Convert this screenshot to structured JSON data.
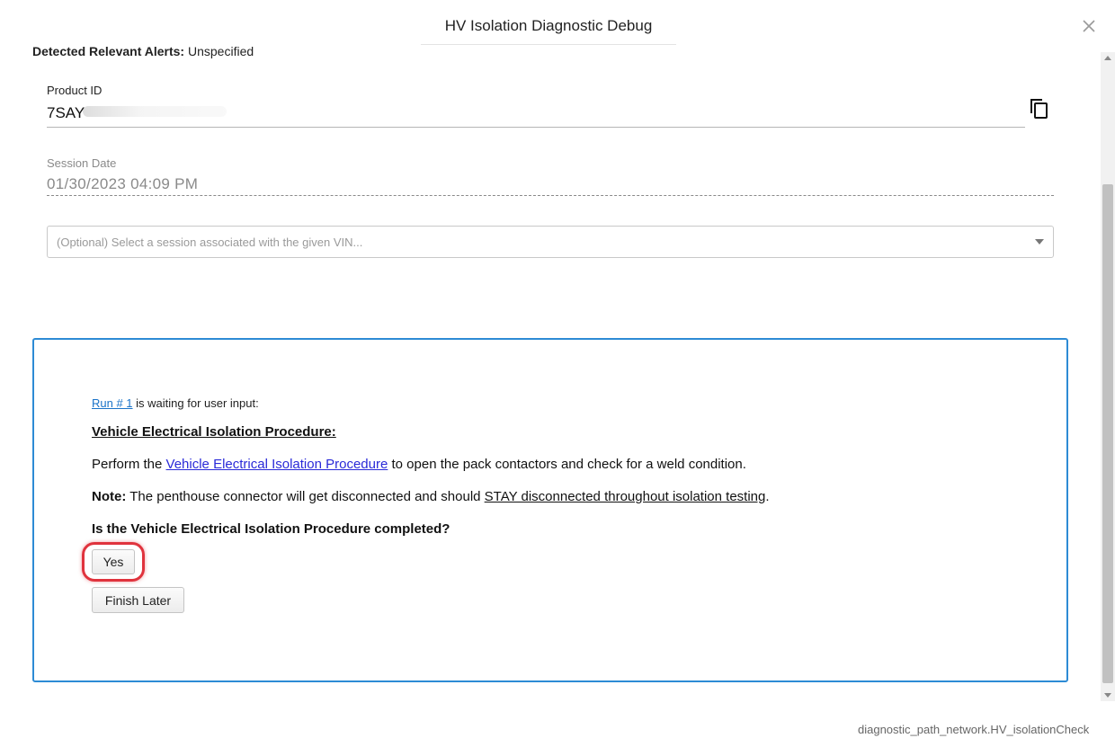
{
  "modal": {
    "title": "HV Isolation Diagnostic Debug",
    "close_icon": "close-icon"
  },
  "alerts": {
    "label": "Detected Relevant Alerts:",
    "value": "Unspecified"
  },
  "product": {
    "label": "Product ID",
    "value": "7SAY",
    "copy_icon": "copy-icon"
  },
  "session_date": {
    "label": "Session Date",
    "value": "01/30/2023 04:09 PM"
  },
  "session_select": {
    "placeholder": "(Optional) Select a session associated with the given VIN..."
  },
  "run": {
    "link_text": "Run # 1",
    "status_text": " is waiting for user input:",
    "procedure_title": "Vehicle Electrical Isolation Procedure:",
    "perform_prefix": "Perform the ",
    "perform_link": "Vehicle Electrical Isolation Procedure",
    "perform_suffix": " to open the pack contactors and check for a weld condition.",
    "note_label": "Note:",
    "note_text": " The penthouse connector will get disconnected and should ",
    "note_underlined": "STAY disconnected throughout isolation testing",
    "note_end": ".",
    "question": "Is the Vehicle Electrical Isolation Procedure completed?",
    "yes_label": "Yes",
    "finish_later_label": "Finish Later"
  },
  "footer": {
    "path_id": "diagnostic_path_network.HV_isolationCheck"
  },
  "colors": {
    "box_border": "#2d8bd5",
    "link": "#1a73c8",
    "procedure_link": "#2a2ad8",
    "highlight": "#e0333d"
  }
}
